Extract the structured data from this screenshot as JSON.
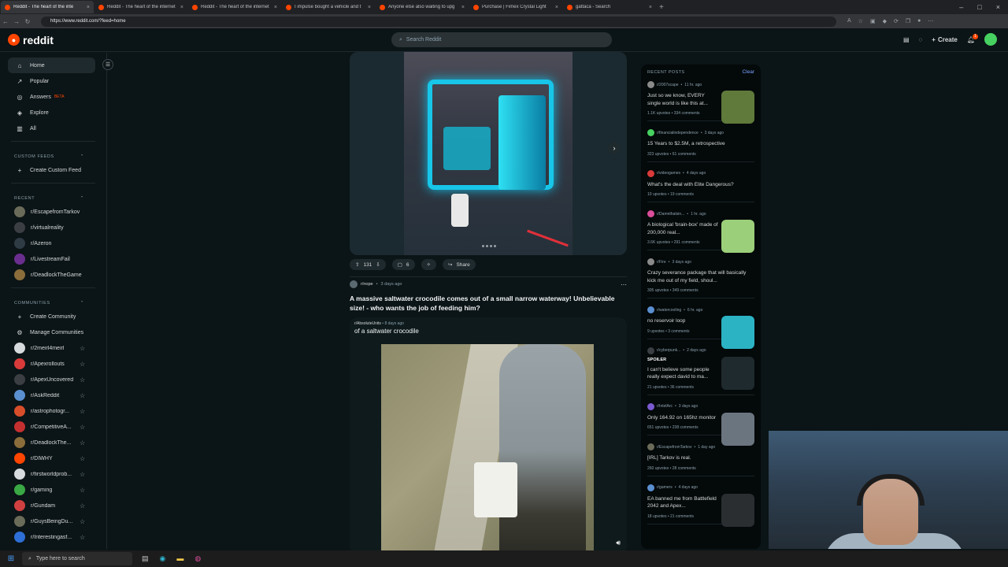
{
  "browser": {
    "tabs": [
      {
        "title": "Reddit - The heart of the inte",
        "active": true
      },
      {
        "title": "Reddit - The heart of the internet",
        "active": false
      },
      {
        "title": "Reddit - The heart of the internet",
        "active": false
      },
      {
        "title": "I impulse bought a vehicle and t",
        "active": false
      },
      {
        "title": "Anyone else also waiting to upg",
        "active": false
      },
      {
        "title": "Purchase | Fimex Crystal Light",
        "active": false
      },
      {
        "title": "gattaca - Search",
        "active": false
      }
    ],
    "url": "https://www.reddit.com/?feed=home"
  },
  "header": {
    "logo_text": "reddit",
    "search_placeholder": "Search Reddit",
    "create_label": "Create",
    "notif_count": "1"
  },
  "sidebar": {
    "nav": [
      {
        "label": "Home",
        "icon": "home-icon",
        "active": true
      },
      {
        "label": "Popular",
        "icon": "popular-icon"
      },
      {
        "label": "Answers",
        "icon": "answers-icon",
        "badge": "BETA"
      },
      {
        "label": "Explore",
        "icon": "explore-icon"
      },
      {
        "label": "All",
        "icon": "all-icon"
      }
    ],
    "custom_feeds_heading": "CUSTOM FEEDS",
    "create_custom_feed": "Create Custom Feed",
    "recent_heading": "RECENT",
    "recent": [
      {
        "name": "r/EscapefromTarkov",
        "color": "#6b6b5a"
      },
      {
        "name": "r/virtualreality",
        "color": "#3b3f44"
      },
      {
        "name": "r/Azeron",
        "color": "#2e3a44"
      },
      {
        "name": "r/LivestreamFail",
        "color": "#6a2e8f"
      },
      {
        "name": "r/DeadlockTheGame",
        "color": "#8a6d3b"
      }
    ],
    "communities_heading": "COMMUNITIES",
    "create_community": "Create Community",
    "manage_communities": "Manage Communities",
    "communities": [
      {
        "name": "r/2meirl4meirl",
        "color": "#d7dadc"
      },
      {
        "name": "r/Apexrollouts",
        "color": "#d93a3a"
      },
      {
        "name": "r/ApexUncovered",
        "color": "#3b3f44"
      },
      {
        "name": "r/AskReddit",
        "color": "#5a8fd0"
      },
      {
        "name": "r/astrophotogr...",
        "color": "#d94e2a"
      },
      {
        "name": "r/CompetitiveA...",
        "color": "#c43030"
      },
      {
        "name": "r/DeadlockThe...",
        "color": "#8a6d3b"
      },
      {
        "name": "r/DIWHY",
        "color": "#ff4500"
      },
      {
        "name": "r/firstworldprob...",
        "color": "#d7dadc"
      },
      {
        "name": "r/gaming",
        "color": "#3aa845"
      },
      {
        "name": "r/Gundam",
        "color": "#d04040"
      },
      {
        "name": "r/GuysBeingDu...",
        "color": "#6b6b5a"
      },
      {
        "name": "r/Interestingasf...",
        "color": "#2d6fd6"
      }
    ]
  },
  "feed": {
    "post1": {
      "upvotes": "131",
      "comments": "6",
      "share": "Share"
    },
    "post2": {
      "subreddit": "r/nope",
      "time": "3 days ago",
      "title": "A massive saltwater crocodile comes out of a small narrow waterway! Unbelievable size! - who wants the job of feeding him?",
      "xpost_sub": "r/AbsoluteUnits",
      "xpost_time": "8 days ago",
      "xpost_title": "of a saltwater crocodile"
    }
  },
  "recent_posts": {
    "heading": "RECENT POSTS",
    "clear": "Clear",
    "items": [
      {
        "sub": "r/2007scape",
        "time": "11 hr. ago",
        "title": "Just so we know, EVERY single world is like this at...",
        "upvotes": "1.1K upvotes",
        "comments": "334 comments",
        "thumb": "#5f7a3a",
        "icon": "#8a8a8a"
      },
      {
        "sub": "r/financialindependence",
        "time": "3 days ago",
        "title": "15 Years to $2.5M, a retrospective",
        "upvotes": "323 upvotes",
        "comments": "61 comments",
        "thumb": "",
        "icon": "#46d160"
      },
      {
        "sub": "r/videogames",
        "time": "4 days ago",
        "title": "What's the deal with Elite Dangerous?",
        "upvotes": "10 upvotes",
        "comments": "19 comments",
        "thumb": "",
        "icon": "#d93a3a"
      },
      {
        "sub": "r/Damnthatsin...",
        "time": "1 hr. ago",
        "title": "A biological 'brain-box' made of 200,000 real...",
        "upvotes": "3.6K upvotes",
        "comments": "291 comments",
        "thumb": "#9ccf7a",
        "icon": "#d94e9a"
      },
      {
        "sub": "r/Fire",
        "time": "3 days ago",
        "title": "Crazy severance package that will basically kick me out of my field, shoul...",
        "upvotes": "305 upvotes",
        "comments": "349 comments",
        "thumb": "",
        "icon": "#8a8a8a"
      },
      {
        "sub": "r/watercooling",
        "time": "6 hr. ago",
        "title": "no reservoir loop",
        "upvotes": "9 upvotes",
        "comments": "3 comments",
        "thumb": "#2bb3c4",
        "icon": "#5a8fd0"
      },
      {
        "sub": "r/cyberpunk...",
        "time": "2 days ago",
        "spoiler": "SPOILER",
        "title": "I can't believe some people really expect david to ma...",
        "upvotes": "21 upvotes",
        "comments": "36 comments",
        "thumb": "#1f2a2e",
        "icon": "#3b3f44"
      },
      {
        "sub": "r/IntelArc",
        "time": "3 days ago",
        "title": "Only 164.92 on 165hz monitor",
        "upvotes": "651 upvotes",
        "comments": "238 comments",
        "thumb": "#6a7580",
        "icon": "#7a5ad0"
      },
      {
        "sub": "r/EscapefromTarkov",
        "time": "1 day ago",
        "title": "[IRL] Tarkov is real.",
        "upvotes": "260 upvotes",
        "comments": "28 comments",
        "thumb": "",
        "icon": "#6b6b5a"
      },
      {
        "sub": "r/gamers",
        "time": "4 days ago",
        "title": "EA banned me from Battlefield 2042 and Apex...",
        "upvotes": "18 upvotes",
        "comments": "21 comments",
        "thumb": "#2a2e30",
        "icon": "#5a8fd0"
      }
    ]
  },
  "taskbar": {
    "search_placeholder": "Type here to search"
  }
}
